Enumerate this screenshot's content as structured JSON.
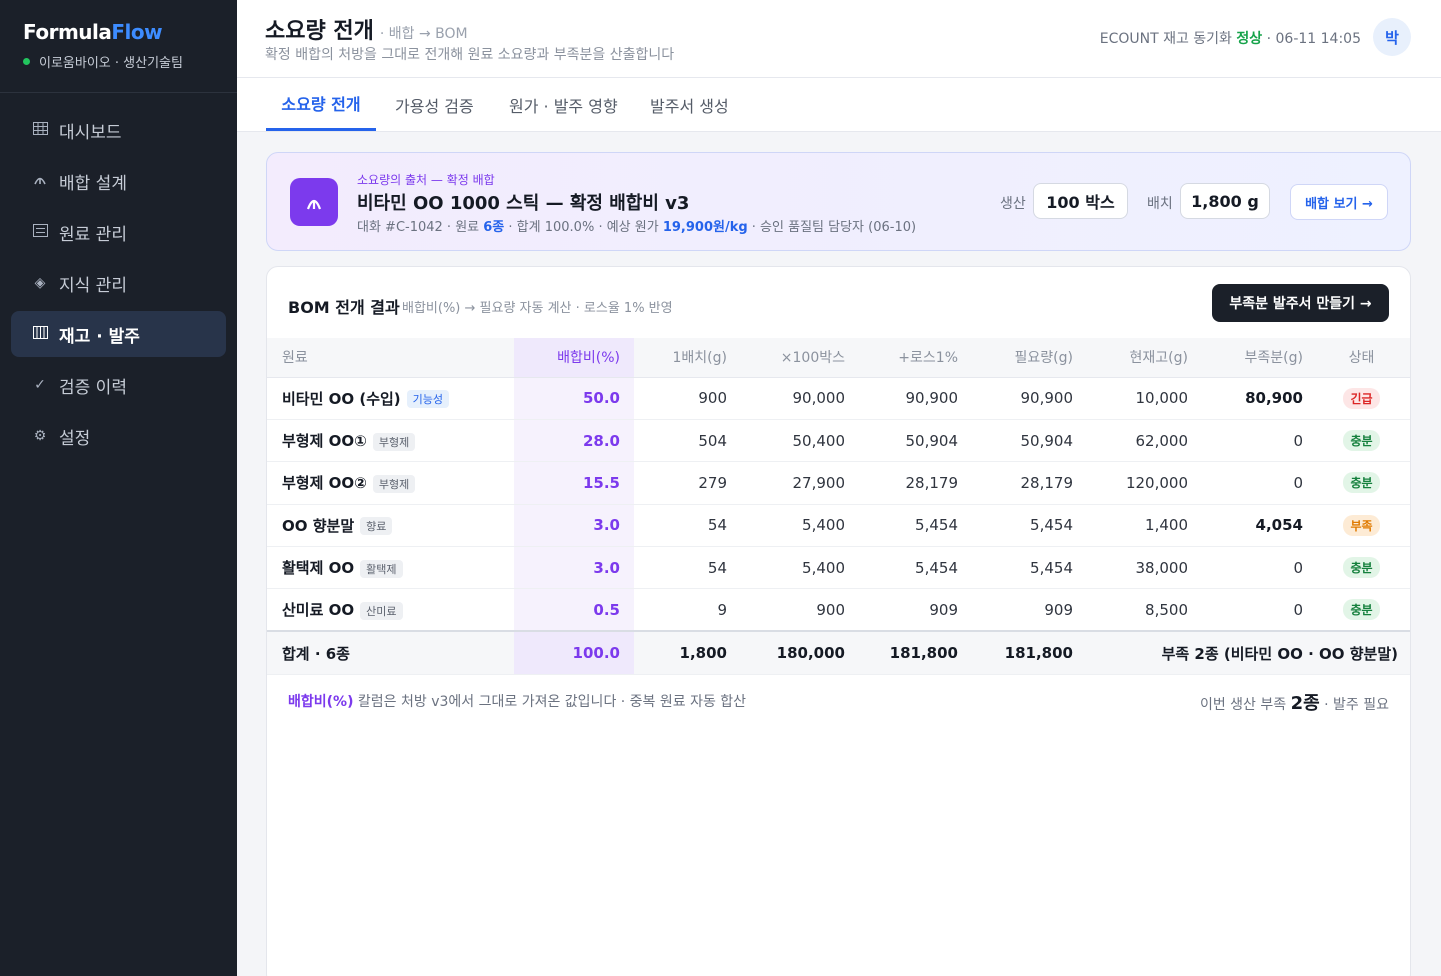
{
  "app": {
    "brand_a": "Formula",
    "brand_b": "Flow",
    "org": "이로움바이오 · 생산기술팀"
  },
  "sidebar": {
    "items": [
      {
        "label": "대시보드",
        "icon": "dashboard-grid-icon"
      },
      {
        "label": "배합 설계",
        "icon": "flask-icon"
      },
      {
        "label": "원료 관리",
        "icon": "list-icon"
      },
      {
        "label": "지식 관리",
        "icon": "diamond-icon"
      },
      {
        "label": "재고 · 발주",
        "icon": "barcode-icon",
        "active": true
      },
      {
        "label": "검증 이력",
        "icon": "check-icon"
      },
      {
        "label": "설정",
        "icon": "gear-icon"
      }
    ]
  },
  "header": {
    "title": "소요량 전개",
    "crumb": "· 배합 → BOM",
    "subtitle": "확정 배합의 처방을 그대로 전개해 원료 소요량과 부족분을 산출합니다",
    "sync_prefix": "ECOUNT 재고 동기화",
    "sync_status": "정상",
    "sync_time": "· 06-11 14:05",
    "avatar": "박"
  },
  "tabs": [
    "소요량 전개",
    "가용성 검증",
    "원가 · 발주 영향",
    "발주서 생성"
  ],
  "source": {
    "label": "소요량의 출처 — 확정 배합",
    "title": "비타민 OO 1000 스틱 — 확정 배합비 v3",
    "meta_a": "대화 #C-1042 · 원료",
    "meta_count": "6종",
    "meta_b": "· 합계 100.0% · 예상 원가",
    "meta_cost": "19,900원/kg",
    "meta_c": "· 승인 품질팀 담당자 (06-10)",
    "prod_label": "생산",
    "prod_value": "100 박스",
    "batch_label": "배치",
    "batch_value": "1,800 g",
    "view_button": "배합 보기 →"
  },
  "bom": {
    "title": "BOM 전개 결과",
    "subtitle": "배합비(%) → 필요량 자동 계산 · 로스율 1% 반영",
    "po_button": "부족분 발주서 만들기 →",
    "columns": [
      "원료",
      "배합비(%)",
      "1배치(g)",
      "×100박스",
      "+로스1%",
      "필요량(g)",
      "현재고(g)",
      "부족분(g)",
      "상태"
    ],
    "rows": [
      {
        "name": "비타민 OO (수입)",
        "tag": "기능성",
        "tag_type": "func",
        "ratio": "50.0",
        "batch": "900",
        "x100": "90,000",
        "loss": "90,900",
        "need": "90,900",
        "stock": "10,000",
        "short": "80,900",
        "short_bold": true,
        "status": "긴급",
        "status_type": "urgent"
      },
      {
        "name": "부형제 OO①",
        "tag": "부형제",
        "tag_type": "",
        "ratio": "28.0",
        "batch": "504",
        "x100": "50,400",
        "loss": "50,904",
        "need": "50,904",
        "stock": "62,000",
        "short": "0",
        "short_bold": false,
        "status": "충분",
        "status_type": "ok"
      },
      {
        "name": "부형제 OO②",
        "tag": "부형제",
        "tag_type": "",
        "ratio": "15.5",
        "batch": "279",
        "x100": "27,900",
        "loss": "28,179",
        "need": "28,179",
        "stock": "120,000",
        "short": "0",
        "short_bold": false,
        "status": "충분",
        "status_type": "ok"
      },
      {
        "name": "OO 향분말",
        "tag": "향료",
        "tag_type": "",
        "ratio": "3.0",
        "batch": "54",
        "x100": "5,400",
        "loss": "5,454",
        "need": "5,454",
        "stock": "1,400",
        "short": "4,054",
        "short_bold": true,
        "status": "부족",
        "status_type": "short"
      },
      {
        "name": "활택제 OO",
        "tag": "활택제",
        "tag_type": "",
        "ratio": "3.0",
        "batch": "54",
        "x100": "5,400",
        "loss": "5,454",
        "need": "5,454",
        "stock": "38,000",
        "short": "0",
        "short_bold": false,
        "status": "충분",
        "status_type": "ok"
      },
      {
        "name": "산미료 OO",
        "tag": "산미료",
        "tag_type": "",
        "ratio": "0.5",
        "batch": "9",
        "x100": "900",
        "loss": "909",
        "need": "909",
        "stock": "8,500",
        "short": "0",
        "short_bold": false,
        "status": "충분",
        "status_type": "ok"
      }
    ],
    "total": {
      "label": "합계 · 6종",
      "ratio": "100.0",
      "batch": "1,800",
      "x100": "180,000",
      "loss": "181,800",
      "need": "181,800",
      "shortage": "부족 2종 (비타민 OO · OO 향분말)"
    },
    "footer_hl": "배합비(%)",
    "footer_text": " 칼럼은 처방 v3에서 그대로 가져온 값입니다 · 중복 원료 자동 합산",
    "footer_r_a": "이번 생산 부족",
    "footer_r_count": "2종",
    "footer_r_b": "· 발주 필요"
  }
}
